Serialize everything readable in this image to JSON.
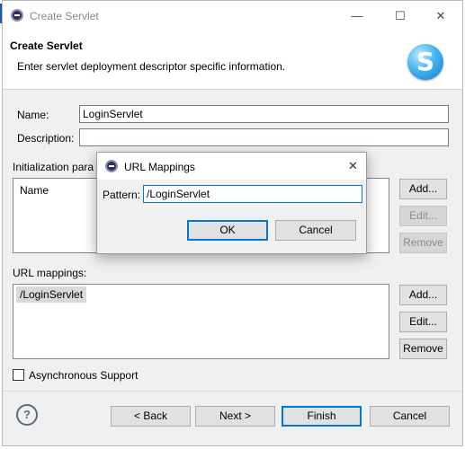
{
  "window": {
    "title": "Create Servlet",
    "minimize": "—",
    "maximize": "☐",
    "close": "✕"
  },
  "header": {
    "title": "Create Servlet",
    "description": "Enter servlet deployment descriptor specific information.",
    "logo_letter": "S"
  },
  "form": {
    "name_label": "Name:",
    "name_value": "LoginServlet",
    "description_label": "Description:",
    "description_value": "",
    "init_params_label": "Initialization para",
    "init_params_column": "Name",
    "init_buttons": {
      "add": "Add...",
      "edit": "Edit...",
      "remove": "Remove"
    },
    "url_mappings_label": "URL mappings:",
    "url_mappings": [
      "/LoginServlet"
    ],
    "url_buttons": {
      "add": "Add...",
      "edit": "Edit...",
      "remove": "Remove"
    },
    "async_label": "Asynchronous Support",
    "async_checked": false
  },
  "footer": {
    "help": "?",
    "back": "< Back",
    "next": "Next >",
    "finish": "Finish",
    "cancel": "Cancel"
  },
  "dialog": {
    "title": "URL Mappings",
    "close": "✕",
    "pattern_label": "Pattern:",
    "pattern_value": "/LoginServlet",
    "ok": "OK",
    "cancel": "Cancel"
  },
  "colors": {
    "accent": "#0078d7",
    "logo": "#1776c7"
  }
}
